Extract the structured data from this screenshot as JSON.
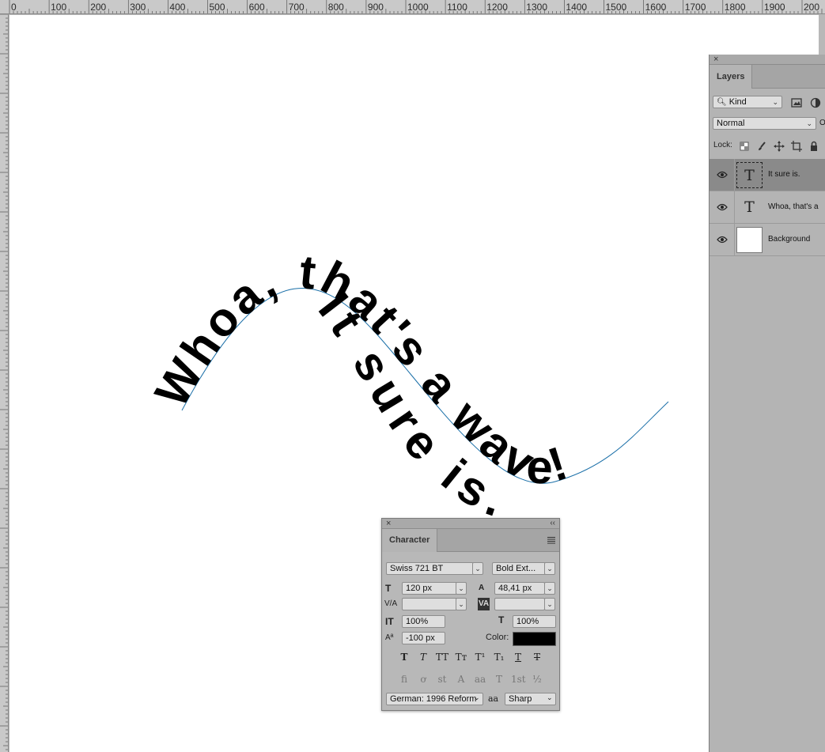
{
  "ruler": {
    "ticks": [
      "0",
      "100",
      "200",
      "300",
      "400",
      "500",
      "600",
      "700",
      "800",
      "900",
      "1000",
      "1100",
      "1200",
      "1300",
      "1400",
      "1500",
      "1600",
      "1700",
      "1800",
      "1900",
      "200"
    ]
  },
  "canvas_text": {
    "wave_text": "Whoa, that's a wave!",
    "reply_text": "It sure is."
  },
  "layers_panel": {
    "tab_label": "Layers",
    "filter_kind": "Kind",
    "blend_mode": "Normal",
    "opacity_cut": "O",
    "lock_label": "Lock:",
    "layers": [
      {
        "name": "It sure is.",
        "type": "text",
        "selected": true
      },
      {
        "name": "Whoa, that's a",
        "type": "text",
        "selected": false
      },
      {
        "name": "Background",
        "type": "image",
        "selected": false
      }
    ]
  },
  "character_panel": {
    "tab_label": "Character",
    "font_family": "Swiss 721 BT",
    "font_style": "Bold Ext...",
    "font_size": "120 px",
    "leading": "48,41 px",
    "kerning": "",
    "tracking": "",
    "vertical_scale": "100%",
    "horizontal_scale": "100%",
    "baseline_shift": "-100 px",
    "color_label": "Color:",
    "color_value": "#000000",
    "language": "German: 1996 Reform",
    "antialias_icon": "aa",
    "antialias": "Sharp",
    "style_buttons": [
      "T",
      "T",
      "TT",
      "Tт",
      "T¹",
      "T₁",
      "T",
      "T"
    ],
    "opentype_buttons": [
      "fi",
      "ơ",
      "st",
      "A",
      "aa",
      "T",
      "1st",
      "½"
    ],
    "icons": {
      "size": "T",
      "leading": "A",
      "kerning": "V/A",
      "tracking": "VA",
      "vscale": "IT",
      "hscale": "T",
      "baseline": "Aª"
    }
  },
  "colors": {
    "ui_gray": "#b8b8b8",
    "path_blue": "#1a6fa8",
    "text_black": "#000000"
  }
}
